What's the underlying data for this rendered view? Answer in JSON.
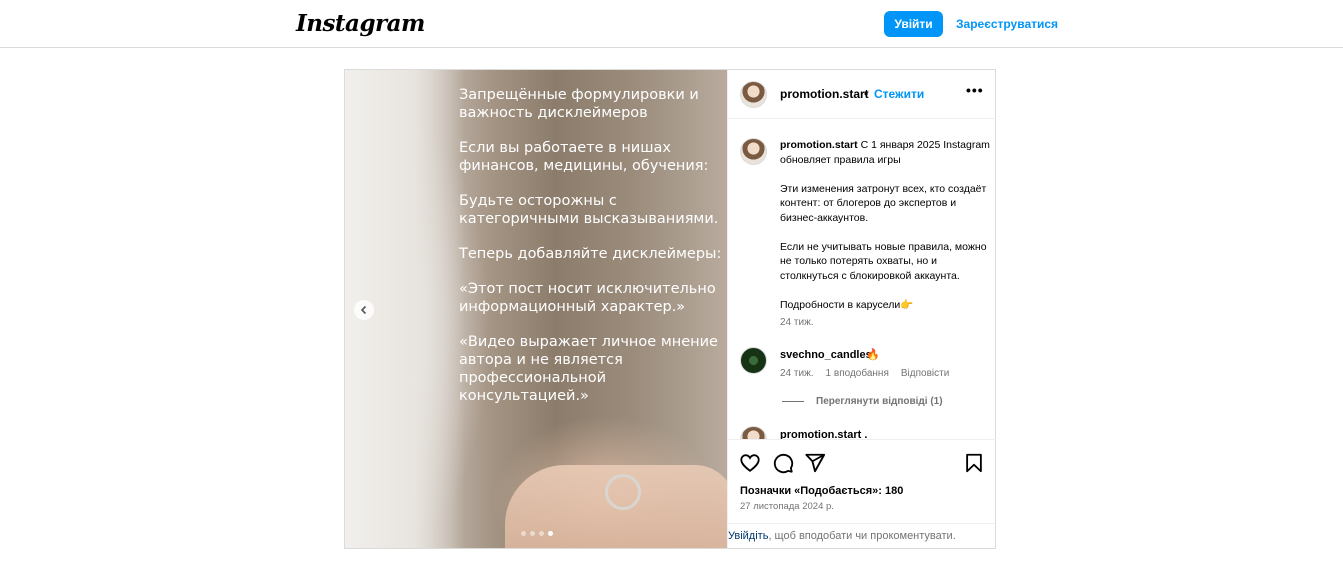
{
  "header": {
    "logo_text": "Instagram",
    "login_label": "Увійти",
    "register_label": "Зареєструватися"
  },
  "post": {
    "author": "promotion.start",
    "separator": "•",
    "follow_label": "Стежити",
    "more_label": "•••",
    "media": {
      "text_blocks": [
        "Запрещённые формулировки и важность дисклеймеров",
        "Если вы работаете в нишах финансов, медицины, обучения:",
        "Будьте осторожны с категоричными высказываниями.",
        "Теперь добавляйте дисклеймеры:",
        "«Этот пост носит исключительно информационный характер.»",
        "«Видео выражает личное мнение автора и не является профессиональной консультацией.»"
      ],
      "slide_count": 4,
      "active_slide": 4
    },
    "caption": {
      "user": "promotion.start",
      "line1": "С 1 января 2025 Instagram обновляет правила игры",
      "para2": "Эти изменения затронут всех, кто создаёт контент: от блогеров до экспертов и бизнес-аккаунтов.",
      "para3": "Если не учитывать новые правила, можно не только потерять охваты, но и столкнуться с блокировкой аккаунта.",
      "para4": "Подробности в карусели👉",
      "time": "24 тиж."
    },
    "comments": [
      {
        "user": "svechno_candles",
        "text": "🔥",
        "time": "24 тиж.",
        "likes": "1 вподобання",
        "reply_label": "Відповісти",
        "view_replies": "Переглянути відповіді (1)"
      },
      {
        "user": "promotion.start",
        "text": "."
      }
    ],
    "likes_text": "Позначки «Подобається»: 180",
    "date": "27 листопада 2024 р.",
    "login_prompt": {
      "link": "Увійдіть",
      "rest": ", щоб вподобати чи прокоментувати."
    }
  },
  "icons": [
    "chevron-left-icon",
    "heart-icon",
    "comment-icon",
    "share-icon",
    "bookmark-icon",
    "more-icon"
  ]
}
